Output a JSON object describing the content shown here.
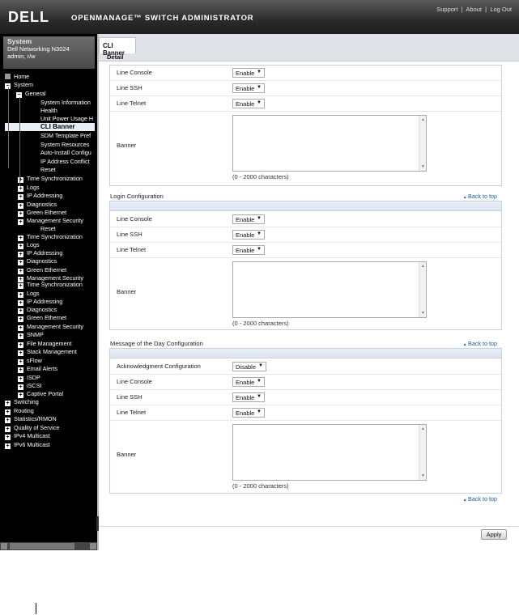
{
  "header": {
    "logo": "DELL",
    "title": "OPENMANAGE™ SWITCH ADMINISTRATOR",
    "links": [
      "Support",
      "About",
      "Log Out"
    ]
  },
  "system": {
    "title": "System",
    "device": "Dell Networking N3024",
    "user": "admin, r/w"
  },
  "tree": [
    {
      "label": "Home",
      "icon": "home-icon"
    },
    {
      "label": "System",
      "exp": "−"
    },
    {
      "label": "General",
      "exp": "−"
    },
    {
      "label": "System Information"
    },
    {
      "label": "Health"
    },
    {
      "label": "Unit Power Usage H"
    },
    {
      "label": "CLI Banner",
      "selected": true
    },
    {
      "label": "SDM Template Pref"
    },
    {
      "label": "System Resources"
    },
    {
      "label": "Auto-Install Configu"
    },
    {
      "label": "IP Address Conflict"
    },
    {
      "label": "Reset"
    },
    {
      "label": "Time Synchronization",
      "exp": "+"
    },
    {
      "label": "Logs",
      "exp": "+"
    },
    {
      "label": "IP Addressing",
      "exp": "+"
    },
    {
      "label": "Diagnostics",
      "exp": "+"
    },
    {
      "label": "Green Ethernet",
      "exp": "+"
    },
    {
      "label": "Management Security",
      "exp": "+"
    },
    {
      "label": "Reset"
    },
    {
      "label": "Time Synchronization",
      "exp": "+"
    },
    {
      "label": "Logs",
      "exp": "+"
    },
    {
      "label": "IP Addressing",
      "exp": "+"
    },
    {
      "label": "Diagnostics",
      "exp": "+"
    },
    {
      "label": "Green Ethernet",
      "exp": "+"
    },
    {
      "label": "Management Security",
      "exp": "+"
    },
    {
      "label": "Time Synchronization",
      "exp": "+"
    },
    {
      "label": "Logs",
      "exp": "+"
    },
    {
      "label": "IP Addressing",
      "exp": "+"
    },
    {
      "label": "Diagnostics",
      "exp": "+"
    },
    {
      "label": "Green Ethernet",
      "exp": "+"
    },
    {
      "label": "Management Security",
      "exp": "+"
    },
    {
      "label": "SNMP",
      "exp": "+"
    },
    {
      "label": "File Management",
      "exp": "+"
    },
    {
      "label": "Stack Management",
      "exp": "+"
    },
    {
      "label": "sFlow",
      "exp": "+"
    },
    {
      "label": "Email Alerts",
      "exp": "+"
    },
    {
      "label": "ISDP",
      "exp": "+"
    },
    {
      "label": "iSCSI",
      "exp": "+"
    },
    {
      "label": "Captive Portal",
      "exp": "+"
    },
    {
      "label": "Switching",
      "exp": "+"
    },
    {
      "label": "Routing",
      "exp": "+"
    },
    {
      "label": "Statistics/RMON",
      "exp": "+"
    },
    {
      "label": "Quality of Service",
      "exp": "+"
    },
    {
      "label": "IPv4 Multicast",
      "exp": "+"
    },
    {
      "label": "IPv6 Multicast",
      "exp": "+"
    }
  ],
  "tab": {
    "label": "CLI Banner",
    "sub": "Detail"
  },
  "sections": [
    {
      "title": "",
      "rows": [
        {
          "label": "Line Console",
          "value": "Enable"
        },
        {
          "label": "Line SSH",
          "value": "Enable"
        },
        {
          "label": "Line Telnet",
          "value": "Enable"
        }
      ],
      "banner_label": "Banner",
      "hint": "(0 - 2000 characters)"
    },
    {
      "title": "Login Configuration",
      "back": "Back to top",
      "rows": [
        {
          "label": "Line Console",
          "value": "Enable"
        },
        {
          "label": "Line SSH",
          "value": "Enable"
        },
        {
          "label": "Line Telnet",
          "value": "Enable"
        }
      ],
      "banner_label": "Banner",
      "hint": "(0 - 2000 characters)"
    },
    {
      "title": "Message of the Day Configuration",
      "back": "Back to top",
      "rows": [
        {
          "label": "Acknowledgment Configuration",
          "value": "Disable"
        },
        {
          "label": "Line Console",
          "value": "Enable"
        },
        {
          "label": "Line SSH",
          "value": "Enable"
        },
        {
          "label": "Line Telnet",
          "value": "Enable"
        }
      ],
      "banner_label": "Banner",
      "hint": "(0 - 2000 characters)"
    }
  ],
  "bottom_back": "Back to top",
  "apply": "Apply"
}
